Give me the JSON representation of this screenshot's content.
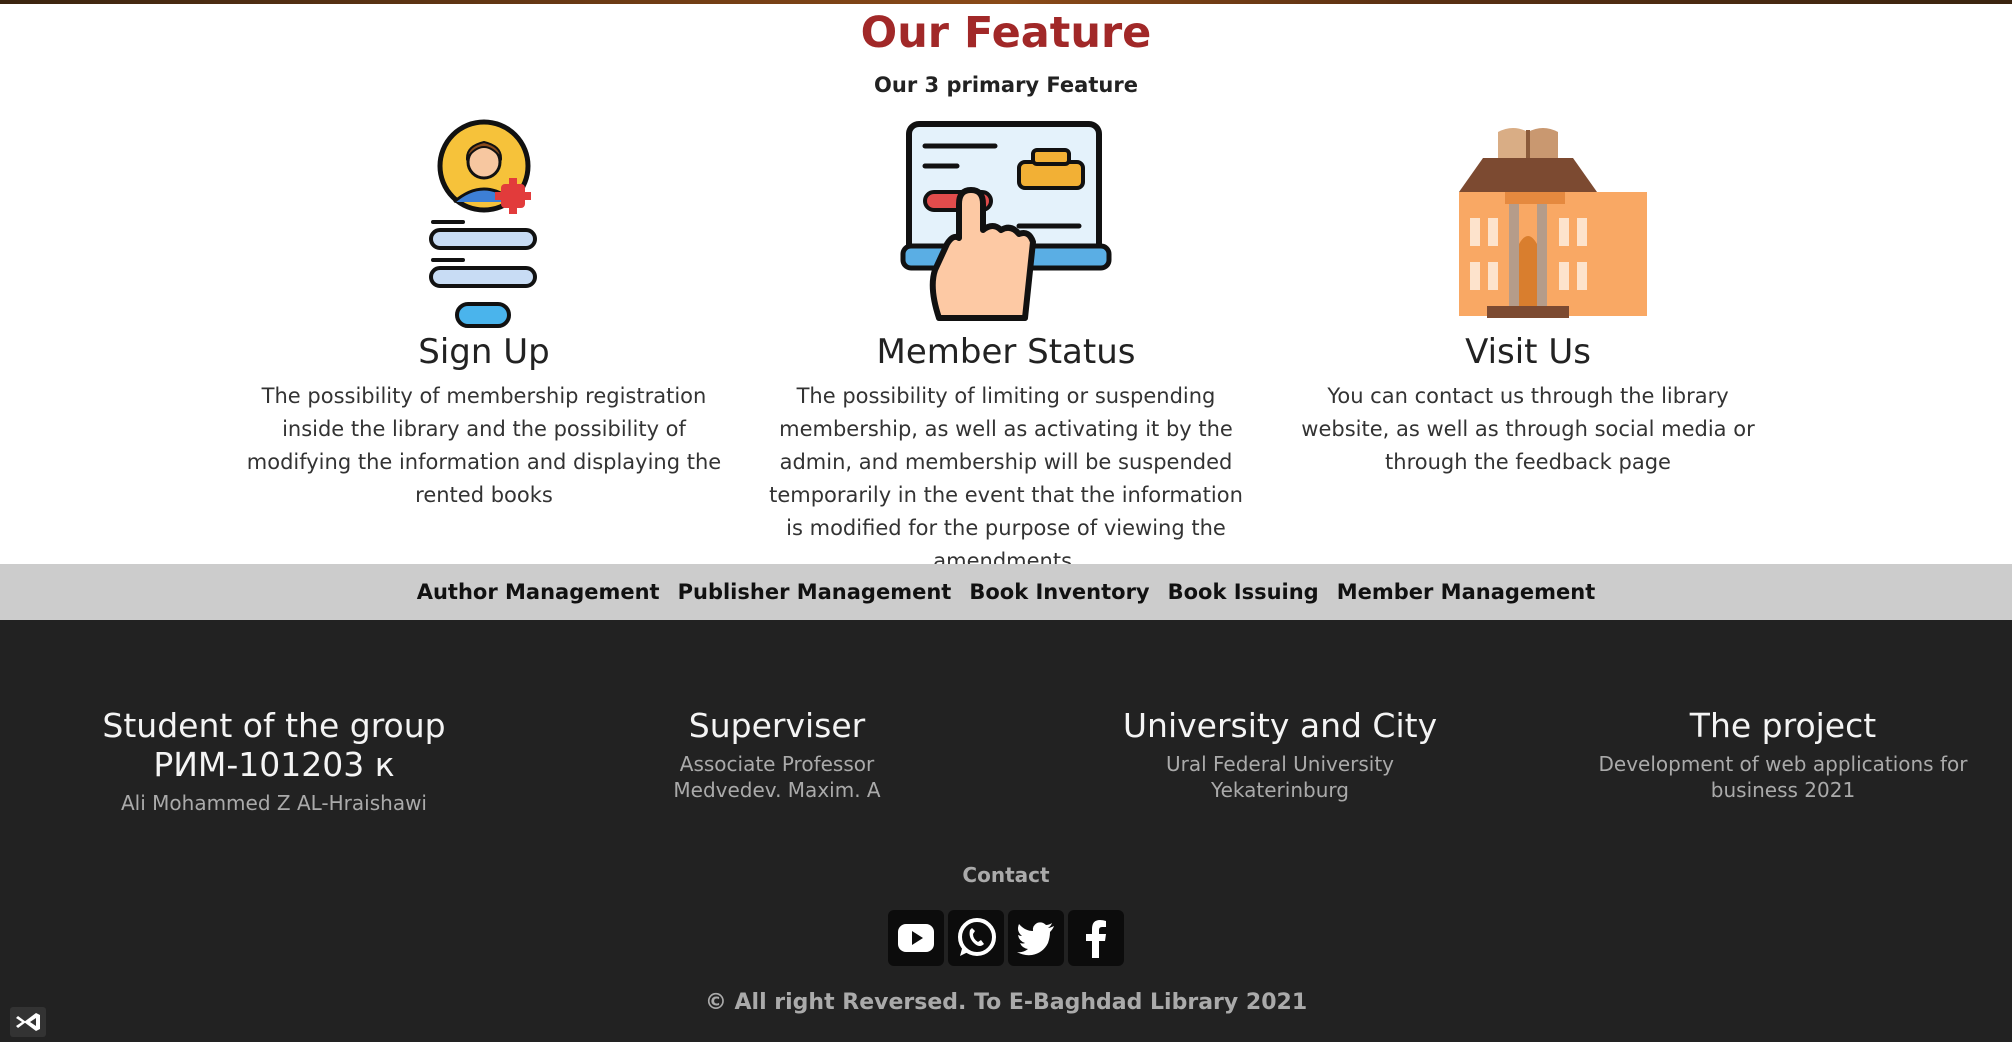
{
  "features": {
    "title": "Our Feature",
    "subtitle": "Our 3 primary Feature",
    "items": [
      {
        "icon": "user-signup-icon",
        "title": "Sign Up",
        "description": "The possibility of membership registration inside the library and the possibility of modifying the information and displaying the rented books"
      },
      {
        "icon": "laptop-touch-icon",
        "title": "Member Status",
        "description": "The possibility of limiting or suspending membership, as well as activating it by the admin, and membership will be suspended temporarily in the event that the information is modified for the purpose of viewing the amendments."
      },
      {
        "icon": "library-building-icon",
        "title": "Visit Us",
        "description": "You can contact us through the library website, as well as through social media or through the feedback page"
      }
    ]
  },
  "nav": {
    "items": [
      "Author Management",
      "Publisher Management",
      "Book Inventory",
      "Book Issuing",
      "Member Management"
    ]
  },
  "footer": {
    "columns": [
      {
        "heading": "Student of the group РИМ-101203 к",
        "text": "Ali Mohammed Z AL-Hraishawi"
      },
      {
        "heading": "Superviser",
        "text": "Associate Professor Medvedev. Maxim. A"
      },
      {
        "heading": "University and City",
        "text": "Ural Federal University Yekaterinburg"
      },
      {
        "heading": "The project",
        "text": "Development of web applications for business 2021"
      }
    ],
    "contact_label": "Contact",
    "socials": [
      "youtube-icon",
      "whatsapp-icon",
      "twitter-icon",
      "facebook-icon"
    ],
    "copyright": "© All right Reversed. To E-Baghdad Library 2021"
  },
  "colors": {
    "heading": "#a12828",
    "footer_bg": "#222222",
    "nav_bg": "#cccccc",
    "footer_text": "#aaaaaa"
  },
  "devtools_badge_icon": "visual-studio-icon"
}
